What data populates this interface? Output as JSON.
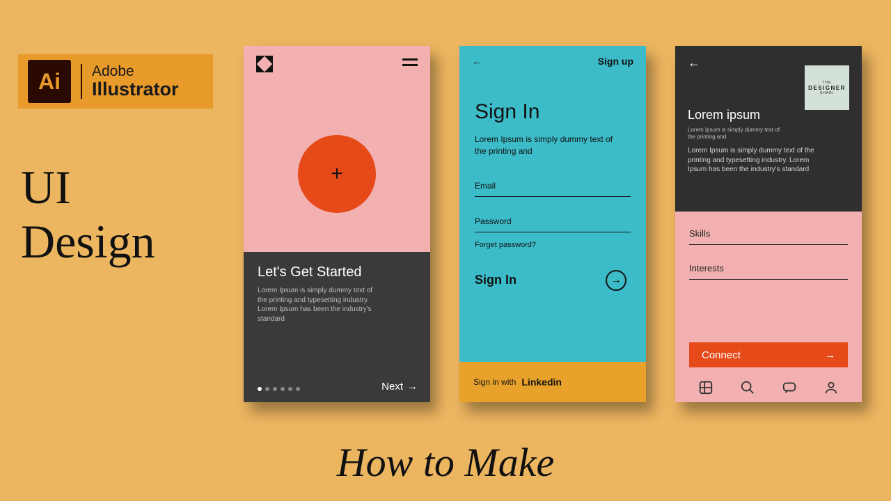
{
  "logo": {
    "icon": "Ai",
    "line1": "Adobe",
    "line2": "Illustrator"
  },
  "headline_line1": "UI",
  "headline_line2": "Design",
  "subheadline": "How to Make",
  "screen1": {
    "plus": "+",
    "title": "Let's Get Started",
    "body": "Lorem Ipsum is simply dummy text of the printing and typesetting industry. Lorem Ipsum has been the industry's standard",
    "next": "Next"
  },
  "screen2": {
    "back": "←",
    "signup": "Sign up",
    "heading": "Sign In",
    "desc": "Lorem Ipsum is simply dummy text of the printing and",
    "email": "Email",
    "password": "Password",
    "forgot": "Forget password?",
    "signin": "Sign In",
    "footer_pre": "Sign in with",
    "footer_link": "Linkedin"
  },
  "screen3": {
    "back": "←",
    "logo_top": "THE",
    "logo_mid": "DESIGNER",
    "logo_bot": "SHARI",
    "title": "Lorem ipsum",
    "sm": "Lorem Ipsum is simply dummy text of the printing and",
    "md": "Lorem Ipsum is simply dummy text of the printing and typesetting industry. Lorem Ipsum has been the industry's standard",
    "skills": "Skills",
    "interests": "Interests",
    "connect": "Connect"
  }
}
